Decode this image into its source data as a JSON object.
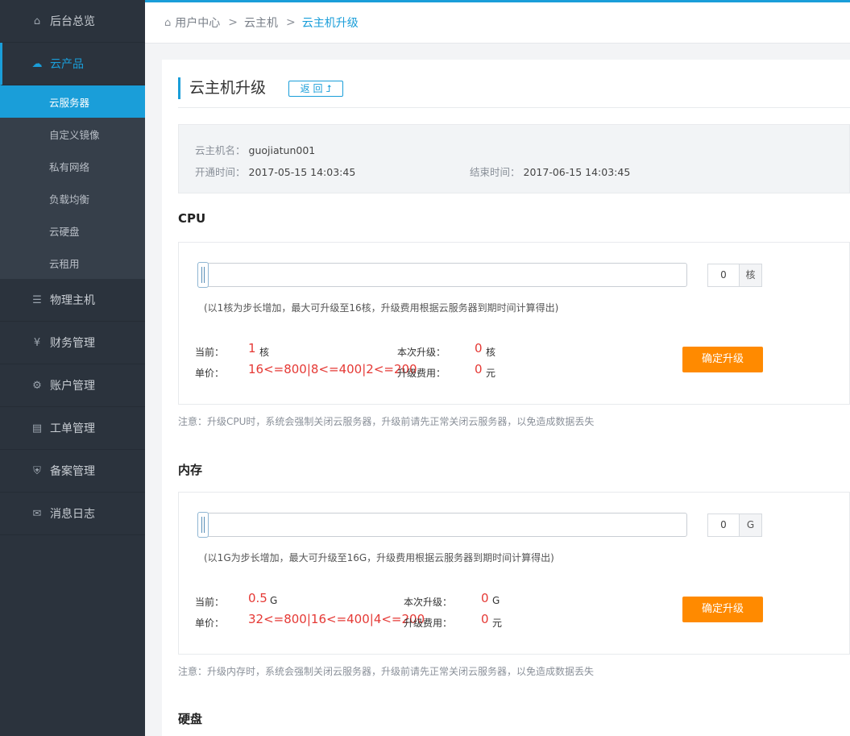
{
  "sidebar": {
    "items": [
      {
        "label": "后台总览",
        "icon": "home-icon",
        "glyph": "⌂"
      },
      {
        "label": "云产品",
        "icon": "cloud-icon",
        "glyph": "☁",
        "active": true
      },
      {
        "label": "物理主机",
        "icon": "server-icon",
        "glyph": "☰"
      },
      {
        "label": "财务管理",
        "icon": "yen-icon",
        "glyph": "¥"
      },
      {
        "label": "账户管理",
        "icon": "gears-icon",
        "glyph": "⚙"
      },
      {
        "label": "工单管理",
        "icon": "clipboard-icon",
        "glyph": "▤"
      },
      {
        "label": "备案管理",
        "icon": "shield-icon",
        "glyph": "⛨"
      },
      {
        "label": "消息日志",
        "icon": "envelope-icon",
        "glyph": "✉"
      }
    ],
    "sub_items": [
      "云服务器",
      "自定义镜像",
      "私有网络",
      "负载均衡",
      "云硬盘",
      "云租用"
    ],
    "active_sub": "云服务器"
  },
  "breadcrumb": {
    "home": "用户中心",
    "mid": "云主机",
    "current": "云主机升级"
  },
  "page": {
    "title": "云主机升级",
    "back_label": "返 回"
  },
  "info": {
    "name_label": "云主机名：",
    "name_value": "guojiatun001",
    "open_label": "开通时间：",
    "open_value": "2017-05-15 14:03:45",
    "end_label": "结束时间：",
    "end_value": "2017-06-15 14:03:45"
  },
  "cpu": {
    "title": "CPU",
    "input_value": "0",
    "unit": "核",
    "hint": "(以1核为步长增加，最大可升级至16核，升级费用根据云服务器到期时间计算得出)",
    "current_label": "当前：",
    "current_value": "1",
    "current_unit": "核",
    "price_label": "单价：",
    "price_value": "16<=800|8<=400|2<=200",
    "upgrade_label": "本次升级：",
    "upgrade_value": "0",
    "upgrade_unit": "核",
    "fee_label": "升级费用：",
    "fee_value": "0",
    "fee_unit": "元",
    "button": "确定升级",
    "note": "注意：升级CPU时，系统会强制关闭云服务器，升级前请先正常关闭云服务器，以免造成数据丢失"
  },
  "memory": {
    "title": "内存",
    "input_value": "0",
    "unit": "G",
    "hint": "(以1G为步长增加，最大可升级至16G，升级费用根据云服务器到期时间计算得出)",
    "current_label": "当前：",
    "current_value": "0.5",
    "current_unit": "G",
    "price_label": "单价：",
    "price_value": "32<=800|16<=400|4<=200",
    "upgrade_label": "本次升级：",
    "upgrade_value": "0",
    "upgrade_unit": "G",
    "fee_label": "升级费用：",
    "fee_value": "0",
    "fee_unit": "元",
    "button": "确定升级",
    "note": "注意：升级内存时，系统会强制关闭云服务器，升级前请先正常关闭云服务器，以免造成数据丢失"
  },
  "disk": {
    "title": "硬盘"
  },
  "colors": {
    "accent": "#1a9ed9",
    "sidebar_bg": "#2b333d",
    "button": "#ff8a00",
    "price": "#e53935"
  }
}
